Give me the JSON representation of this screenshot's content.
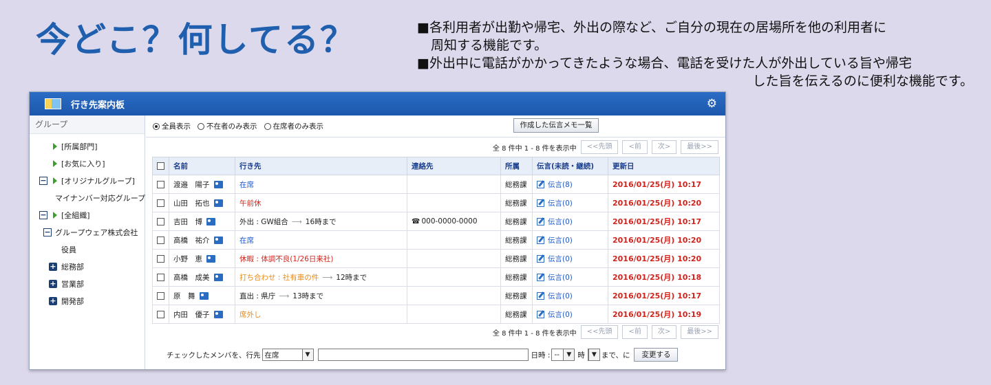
{
  "hero": {
    "title": "今どこ？何してる？",
    "desc_line1": "■各利用者が出勤や帰宅、外出の際など、ご自分の現在の居場所を他の利用者に",
    "desc_line2": "周知する機能です。",
    "desc_line3": "■外出中に電話がかかってきたような場合、電話を受けた人が外出している旨や帰宅",
    "desc_line4": "した旨を伝えるのに便利な機能です。"
  },
  "window": {
    "title": "行き先案内板",
    "settings_icon": "gear-icon"
  },
  "sidebar": {
    "heading": "グループ",
    "items": [
      {
        "label": "[所属部門]"
      },
      {
        "label": "[お気に入り]"
      },
      {
        "label": "[オリジナルグループ]"
      },
      {
        "label": "マイナンバー対応グループ"
      },
      {
        "label": "[全組織]"
      },
      {
        "label": "グループウェア株式会社"
      },
      {
        "label": "役員"
      },
      {
        "label": "総務部"
      },
      {
        "label": "営業部"
      },
      {
        "label": "開発部"
      }
    ]
  },
  "filters": {
    "all": "全員表示",
    "absent": "不在者のみ表示",
    "present": "在席者のみ表示",
    "selected": "all",
    "memo_button": "作成した伝言メモ一覧"
  },
  "pager": {
    "summary": "全 8 件中 1 - 8 件を表示中",
    "first": "<<先頭",
    "prev": "<前",
    "next": "次>",
    "last": "最後>>"
  },
  "table": {
    "headers": {
      "name": "名前",
      "destination": "行き先",
      "contact": "連絡先",
      "dept": "所属",
      "memo": "伝言(未読・継続)",
      "updated": "更新日"
    },
    "rows": [
      {
        "name": "渡邉　陽子",
        "dest": "在席",
        "dest_color": "#1f57c3",
        "dest_until": "",
        "contact": "",
        "dept": "総務課",
        "memo": "伝言(8)",
        "updated": "2016/01/25(月) 10:17"
      },
      {
        "name": "山田　拓也",
        "dest": "午前休",
        "dest_color": "#d1231c",
        "dest_until": "",
        "contact": "",
        "dept": "総務課",
        "memo": "伝言(0)",
        "updated": "2016/01/25(月) 10:20"
      },
      {
        "name": "吉田　博",
        "dest": "外出 : GW組合",
        "dest_color": "#222222",
        "dest_until": "16時まで",
        "contact": "000-0000-0000",
        "dept": "総務課",
        "memo": "伝言(0)",
        "updated": "2016/01/25(月) 10:17"
      },
      {
        "name": "高橋　祐介",
        "dest": "在席",
        "dest_color": "#1f57c3",
        "dest_until": "",
        "contact": "",
        "dept": "総務課",
        "memo": "伝言(0)",
        "updated": "2016/01/25(月) 10:20"
      },
      {
        "name": "小野　恵",
        "dest": "休暇 : 体調不良(1/26日来社)",
        "dest_color": "#d1231c",
        "dest_until": "",
        "contact": "",
        "dept": "総務課",
        "memo": "伝言(0)",
        "updated": "2016/01/25(月) 10:20"
      },
      {
        "name": "高橋　成美",
        "dest": "打ち合わせ : 社有車の件",
        "dest_color": "#e98a13",
        "dest_until": "12時まで",
        "contact": "",
        "dept": "総務課",
        "memo": "伝言(0)",
        "updated": "2016/01/25(月) 10:18"
      },
      {
        "name": "原　舞",
        "dest": "直出 : 県庁",
        "dest_color": "#222222",
        "dest_until": "13時まで",
        "contact": "",
        "dept": "総務課",
        "memo": "伝言(0)",
        "updated": "2016/01/25(月) 10:17"
      },
      {
        "name": "内田　優子",
        "dest": "席外し",
        "dest_color": "#e98a13",
        "dest_until": "",
        "contact": "",
        "dept": "総務課",
        "memo": "伝言(0)",
        "updated": "2016/01/25(月) 10:19"
      }
    ]
  },
  "bottom": {
    "label": "チェックしたメンバを、行先",
    "dest_select": "在席",
    "datetime_label": "日時 :",
    "time_select": "--",
    "hour_label": "時",
    "until_label": "まで、に",
    "change_button": "変更する"
  }
}
